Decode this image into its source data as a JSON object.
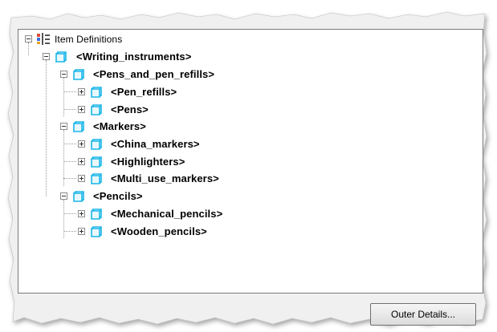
{
  "tree": {
    "root": {
      "label": "Item Definitions",
      "icon": "item-definitions-icon"
    },
    "nodes": [
      {
        "label": "<Writing_instruments>",
        "level": 1,
        "expanded": true
      },
      {
        "label": "<Pens_and_pen_refills>",
        "level": 2,
        "expanded": true
      },
      {
        "label": "<Pen_refills>",
        "level": 3,
        "expanded": false
      },
      {
        "label": "<Pens>",
        "level": 3,
        "expanded": false
      },
      {
        "label": "<Markers>",
        "level": 2,
        "expanded": true
      },
      {
        "label": "<China_markers>",
        "level": 3,
        "expanded": false
      },
      {
        "label": "<Highlighters>",
        "level": 3,
        "expanded": false
      },
      {
        "label": "<Multi_use_markers>",
        "level": 3,
        "expanded": false
      },
      {
        "label": "<Pencils>",
        "level": 2,
        "expanded": true
      },
      {
        "label": "<Mechanical_pencils>",
        "level": 3,
        "expanded": false
      },
      {
        "label": "<Wooden_pencils>",
        "level": 3,
        "expanded": false
      }
    ]
  },
  "buttons": {
    "ok_label": "Outer Details..."
  },
  "colors": {
    "node_icon": "#1ab6e8",
    "panel_border": "#7a7a7a",
    "dialog_bg": "#f0f0f0"
  }
}
